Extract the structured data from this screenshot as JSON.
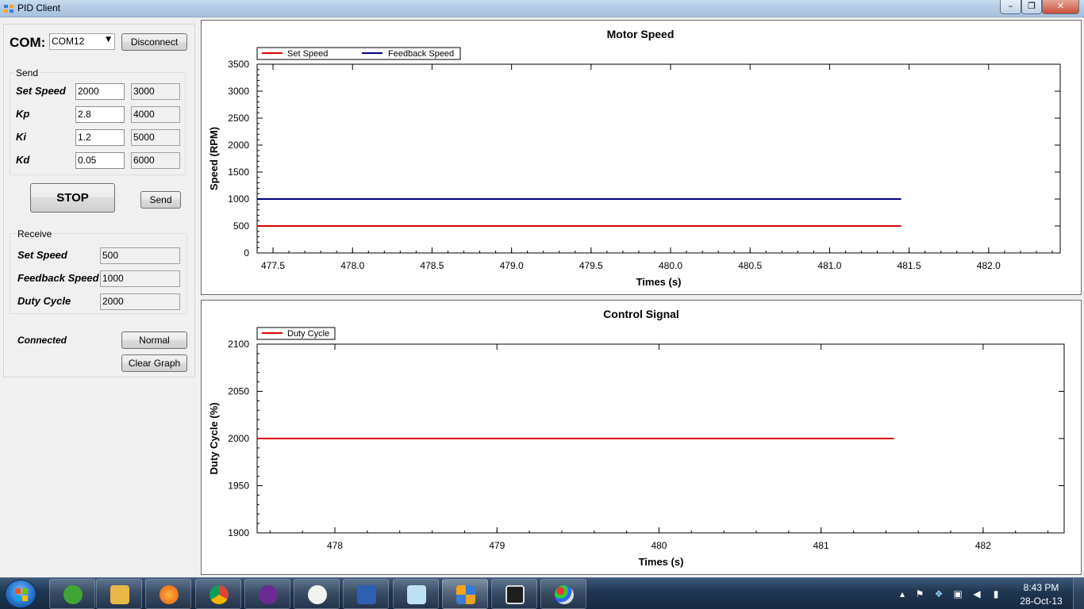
{
  "window": {
    "title": "PID Client",
    "min": "–",
    "max": "❐",
    "close": "✕"
  },
  "com": {
    "label": "COM:",
    "port": "COM12",
    "disconnect_label": "Disconnect"
  },
  "send_group": {
    "title": "Send",
    "rows": [
      {
        "label": "Set Speed",
        "value": "2000",
        "preset": "3000"
      },
      {
        "label": "Kp",
        "value": "2.8",
        "preset": "4000"
      },
      {
        "label": "Ki",
        "value": "1.2",
        "preset": "5000"
      },
      {
        "label": "Kd",
        "value": "0.05",
        "preset": "6000"
      }
    ]
  },
  "stop_label": "STOP",
  "send_label": "Send",
  "receive_group": {
    "title": "Receive",
    "rows": [
      {
        "label": "Set Speed",
        "value": "500"
      },
      {
        "label": "Feedback Speed",
        "value": "1000"
      },
      {
        "label": "Duty Cycle",
        "value": "2000"
      }
    ]
  },
  "status": "Connected",
  "normal_label": "Normal",
  "clear_graph_label": "Clear Graph",
  "colors": {
    "set": "#dd0000",
    "feedback": "#000080",
    "duty": "#dd0000"
  },
  "chart_data": [
    {
      "type": "line",
      "title": "Motor Speed",
      "xlabel": "Times (s)",
      "ylabel": "Speed (RPM)",
      "xlim": [
        477.4,
        482.45
      ],
      "ylim": [
        0,
        3500
      ],
      "xticks": [
        477.5,
        478.0,
        478.5,
        479.0,
        479.5,
        480.0,
        480.5,
        481.0,
        481.5,
        482.0
      ],
      "xtick_labels": [
        "477.5",
        "478.0",
        "478.5",
        "479.0",
        "479.5",
        "480.0",
        "480.5",
        "481.0",
        "481.5",
        "482.0"
      ],
      "yticks": [
        0,
        500,
        1000,
        1500,
        2000,
        2500,
        3000,
        3500
      ],
      "ytick_labels": [
        "0",
        "500",
        "1000",
        "1500",
        "2000",
        "2500",
        "3000",
        "3500"
      ],
      "legend_position": "top-left",
      "grid": false,
      "series": [
        {
          "name": "Set Speed",
          "color": "#dd0000",
          "x": [
            477.4,
            481.45
          ],
          "y": [
            500,
            500
          ]
        },
        {
          "name": "Feedback Speed",
          "color": "#000080",
          "x": [
            477.4,
            481.45
          ],
          "y": [
            1000,
            1000
          ]
        }
      ]
    },
    {
      "type": "line",
      "title": "Control Signal",
      "xlabel": "Times (s)",
      "ylabel": "Duty Cycle (%)",
      "xlim": [
        477.52,
        482.5
      ],
      "ylim": [
        1900,
        2100
      ],
      "xticks": [
        478,
        479,
        480,
        481,
        482
      ],
      "xtick_labels": [
        "478",
        "479",
        "480",
        "481",
        "482"
      ],
      "yticks": [
        1900,
        1950,
        2000,
        2050,
        2100
      ],
      "ytick_labels": [
        "1900",
        "1950",
        "2000",
        "2050",
        "2100"
      ],
      "legend_position": "top-left",
      "grid": false,
      "series": [
        {
          "name": "Duty Cycle",
          "color": "#dd0000",
          "x": [
            477.52,
            481.45
          ],
          "y": [
            2000,
            2000
          ]
        }
      ]
    }
  ],
  "taskbar": {
    "apps": [
      "start-orb",
      "clover-app",
      "media-center",
      "firefox",
      "chrome",
      "yahoo-messenger",
      "foobar-fox",
      "hma-vpn",
      "notes-app",
      "pid-client",
      "console-app",
      "paint-app"
    ],
    "clock_time": "8:43 PM",
    "clock_date": "28-Oct-13"
  }
}
